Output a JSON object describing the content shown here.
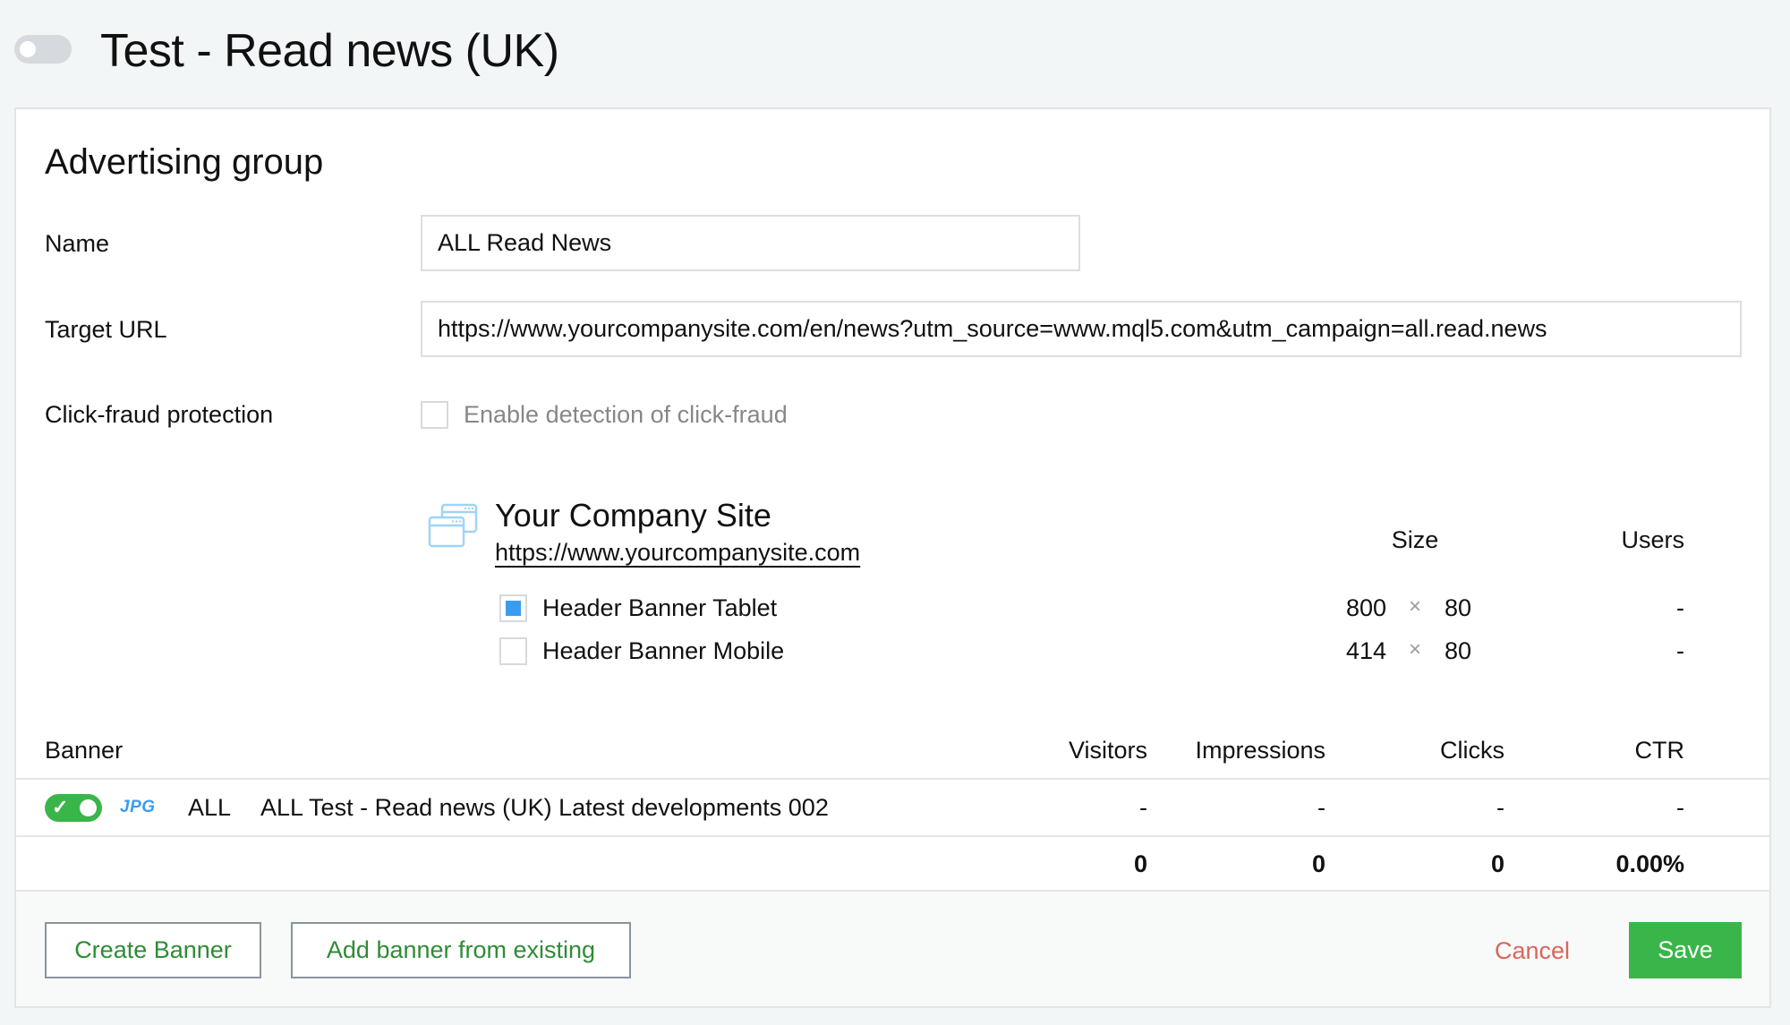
{
  "header": {
    "campaign_enabled": false,
    "title": "Test - Read news (UK)"
  },
  "form": {
    "section_title": "Advertising group",
    "name": {
      "label": "Name",
      "value": "ALL Read News"
    },
    "target_url": {
      "label": "Target URL",
      "value": "https://www.yourcompanysite.com/en/news?utm_source=www.mql5.com&utm_campaign=all.read.news"
    },
    "click_fraud": {
      "label": "Click-fraud protection",
      "checkbox_label": "Enable detection of click-fraud",
      "checked": false
    }
  },
  "site": {
    "icon": "browser-windows-icon",
    "name": "Your Company Site",
    "url": "https://www.yourcompanysite.com",
    "columns": {
      "size": "Size",
      "users": "Users"
    },
    "placements": [
      {
        "label": "Header Banner Tablet",
        "checked": true,
        "width": "800",
        "times": "×",
        "height": "80",
        "users": "-"
      },
      {
        "label": "Header Banner Mobile",
        "checked": false,
        "width": "414",
        "times": "×",
        "height": "80",
        "users": "-"
      }
    ]
  },
  "banners": {
    "columns": {
      "banner": "Banner",
      "visitors": "Visitors",
      "impressions": "Impressions",
      "clicks": "Clicks",
      "ctr": "CTR"
    },
    "rows": [
      {
        "enabled": true,
        "format": "JPG",
        "scope": "ALL",
        "name": "ALL Test - Read news (UK) Latest developments 002",
        "visitors": "-",
        "impressions": "-",
        "clicks": "-",
        "ctr": "-"
      }
    ],
    "totals": {
      "visitors": "0",
      "impressions": "0",
      "clicks": "0",
      "ctr": "0.00%"
    }
  },
  "footer": {
    "create_banner": "Create Banner",
    "add_existing": "Add banner from existing",
    "cancel": "Cancel",
    "save": "Save"
  },
  "colors": {
    "accent_green": "#3ab54a",
    "accent_blue": "#3a9cf0",
    "cancel_red": "#d9655b"
  }
}
